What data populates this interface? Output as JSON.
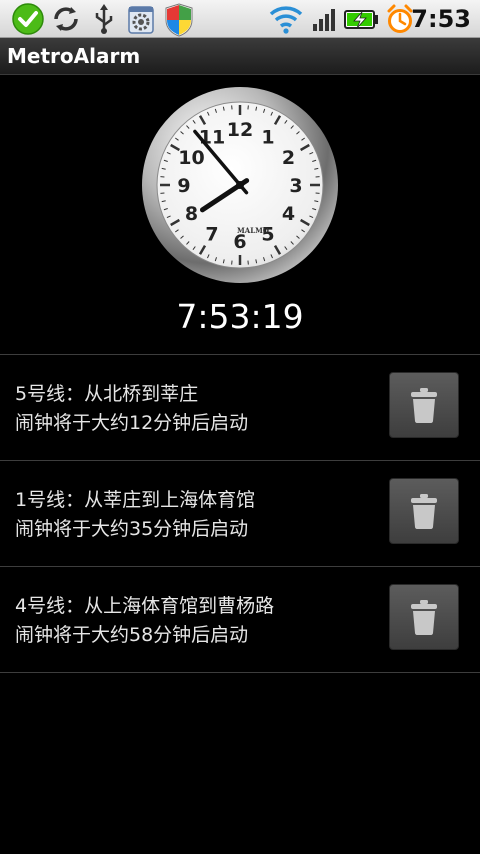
{
  "status_bar": {
    "icons": [
      "check-circle-icon",
      "sync-icon",
      "usb-icon",
      "settings-app-icon",
      "shield-icon",
      "wifi-icon",
      "signal-icon",
      "battery-charging-icon",
      "alarm-clock-icon"
    ],
    "time": "7:53"
  },
  "app": {
    "title": "MetroAlarm"
  },
  "clock": {
    "brand": "MALMO",
    "digital_time": "7:53:19",
    "dial_numbers": [
      "12",
      "1",
      "2",
      "3",
      "4",
      "5",
      "6",
      "7",
      "8",
      "9",
      "10",
      "11"
    ]
  },
  "alarms": [
    {
      "line1": "5号线：从北桥到莘庄",
      "line2": "闹钟将于大约12分钟后启动"
    },
    {
      "line1": "1号线：从莘庄到上海体育馆",
      "line2": "闹钟将于大约35分钟后启动"
    },
    {
      "line1": "4号线：从上海体育馆到曹杨路",
      "line2": "闹钟将于大约58分钟后启动"
    }
  ],
  "colors": {
    "background": "#000000",
    "status_bar": "#e0e0e0",
    "battery": "#33cc00",
    "alarm_icon": "#ff8800"
  }
}
